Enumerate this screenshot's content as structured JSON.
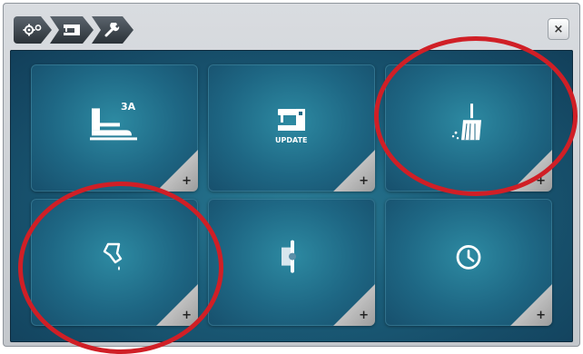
{
  "window": {
    "breadcrumbs": [
      {
        "icon": "settings-gears-icon"
      },
      {
        "icon": "sewing-machine-icon"
      },
      {
        "icon": "wrench-icon"
      }
    ],
    "close_label": "×"
  },
  "tiles": [
    {
      "icon": "presser-foot-icon",
      "label": "3A",
      "corner_label": "+"
    },
    {
      "icon": "machine-update-icon",
      "label": "UPDATE",
      "corner_label": "+"
    },
    {
      "icon": "cleaning-brush-icon",
      "corner_label": "+"
    },
    {
      "icon": "oil-drop-icon",
      "corner_label": "+"
    },
    {
      "icon": "bobbin-case-icon",
      "corner_label": "+"
    },
    {
      "icon": "clock-icon",
      "corner_label": "+"
    }
  ],
  "colors": {
    "panel": "#1b5e7a",
    "tile": "#1e6784",
    "highlight_ring": "#d01f26"
  }
}
